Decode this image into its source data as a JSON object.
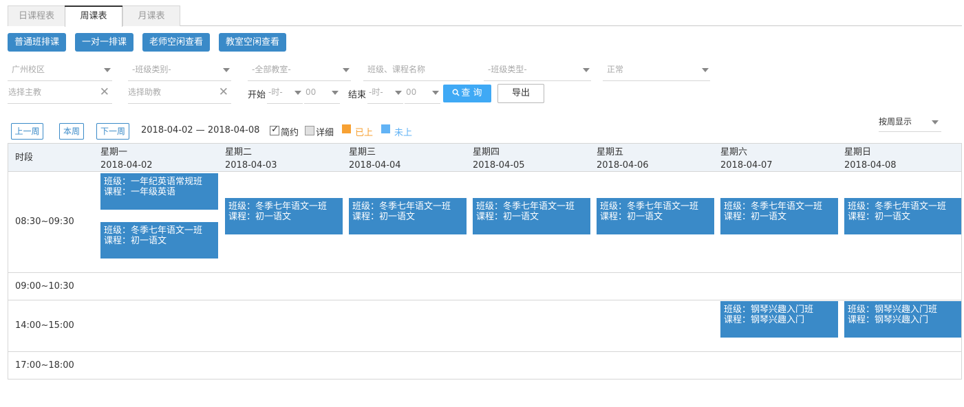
{
  "tabs": [
    "日课程表",
    "周课表",
    "月课表"
  ],
  "actions": [
    "普通班排课",
    "一对一排课",
    "老师空闲查看",
    "教室空闲查看"
  ],
  "filters": {
    "campus": "广州校区",
    "class_category": "-班级类别-",
    "classroom": "-全部教室-",
    "search_placeholder": "班级、课程名称",
    "class_type": "-班级类型-",
    "status": "正常",
    "main_teacher_placeholder": "选择主教",
    "assistant_placeholder": "选择助教",
    "start_label": "开始",
    "end_label": "结束",
    "hour_placeholder": "-时-",
    "minute_value": "00",
    "query_label": "查 询",
    "export_label": "导出"
  },
  "week_nav": {
    "prev": "上一周",
    "current": "本周",
    "next": "下一周",
    "range": "2018-04-02 — 2018-04-08",
    "brief": "简约",
    "detail": "详细",
    "legend_done": "已上",
    "legend_pending": "未上",
    "legend_done_color": "#f7a133",
    "legend_pending_color": "#62b3f5",
    "view_mode": "按周显示"
  },
  "grid": {
    "period_header": "时段",
    "days": [
      {
        "weekday": "星期一",
        "date": "2018-04-02"
      },
      {
        "weekday": "星期二",
        "date": "2018-04-03"
      },
      {
        "weekday": "星期三",
        "date": "2018-04-04"
      },
      {
        "weekday": "星期四",
        "date": "2018-04-05"
      },
      {
        "weekday": "星期五",
        "date": "2018-04-06"
      },
      {
        "weekday": "星期六",
        "date": "2018-04-07"
      },
      {
        "weekday": "星期日",
        "date": "2018-04-08"
      }
    ],
    "slots": [
      "08:30~09:30",
      "09:00~10:30",
      "14:00~15:00",
      "17:00~18:00"
    ],
    "events": [
      {
        "class": "班级：一年纪英语常规班",
        "course": "课程：一年级英语"
      },
      {
        "class": "班级：冬季七年语文一班",
        "course": "课程：初一语文"
      },
      {
        "class": "班级：冬季七年语文一班",
        "course": "课程：初一语文"
      },
      {
        "class": "班级：冬季七年语文一班",
        "course": "课程：初一语文"
      },
      {
        "class": "班级：冬季七年语文一班",
        "course": "课程：初一语文"
      },
      {
        "class": "班级：冬季七年语文一班",
        "course": "课程：初一语文"
      },
      {
        "class": "班级：冬季七年语文一班",
        "course": "课程：初一语文"
      },
      {
        "class": "班级：冬季七年语文一班",
        "course": "课程：初一语文"
      },
      {
        "class": "班级：钢琴兴趣入门班",
        "course": "课程：钢琴兴趣入门"
      },
      {
        "class": "班级：钢琴兴趣入门班",
        "course": "课程：钢琴兴趣入门"
      }
    ],
    "event_color": "#3a8ac8"
  }
}
